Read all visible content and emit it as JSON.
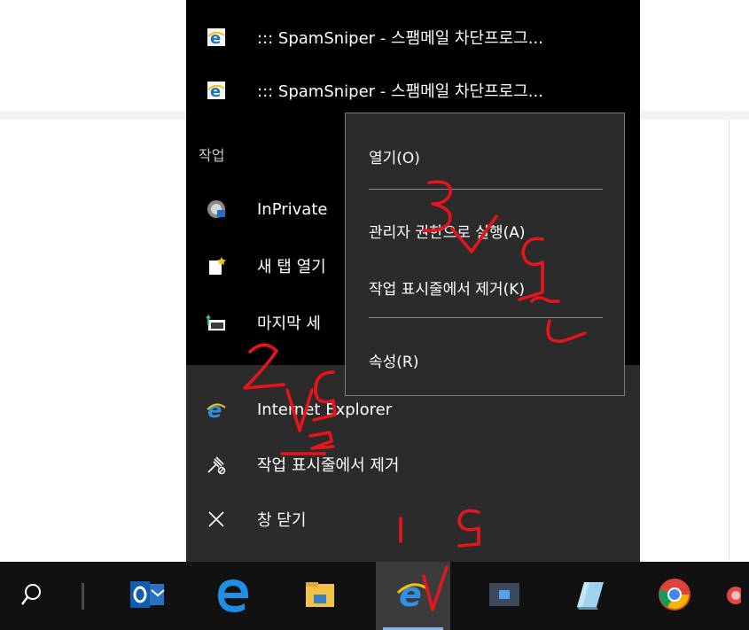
{
  "jumplist": {
    "recent": [
      {
        "icon": "ie-page-icon",
        "label": "::: SpamSniper - 스팸메일 차단프로그..."
      },
      {
        "icon": "ie-page-icon",
        "label": "::: SpamSniper - 스팸메일 차단프로그..."
      }
    ],
    "tasks_header": "작업",
    "tasks": [
      {
        "icon": "inprivate-icon",
        "label": "InPrivate"
      },
      {
        "icon": "new-tab-icon",
        "label": "새 탭 열기"
      },
      {
        "icon": "reopen-session-icon",
        "label": "마지막 세"
      }
    ],
    "app_items": [
      {
        "icon": "internet-explorer-icon",
        "label": "Internet Explorer"
      },
      {
        "icon": "unpin-icon",
        "label": "작업 표시줄에서 제거"
      },
      {
        "icon": "close-icon",
        "label": "창 닫기"
      }
    ]
  },
  "context_menu": {
    "open": "열기(O)",
    "run_as_admin": "관리자 권한으로 실행(A)",
    "unpin": "작업 표시줄에서 제거(K)",
    "properties": "속성(R)"
  },
  "taskbar": {
    "items": [
      "search-icon",
      "outlook-icon",
      "edge-icon",
      "file-explorer-icon",
      "internet-explorer-icon",
      "app-folder-icon",
      "notepad-icon",
      "chrome-icon"
    ],
    "accent": "#8ab4f8"
  },
  "annotations": {
    "ink_color": "#e8141b",
    "notes": [
      "1",
      "2",
      "3",
      "9",
      "9",
      "2",
      "9",
      "2"
    ]
  }
}
